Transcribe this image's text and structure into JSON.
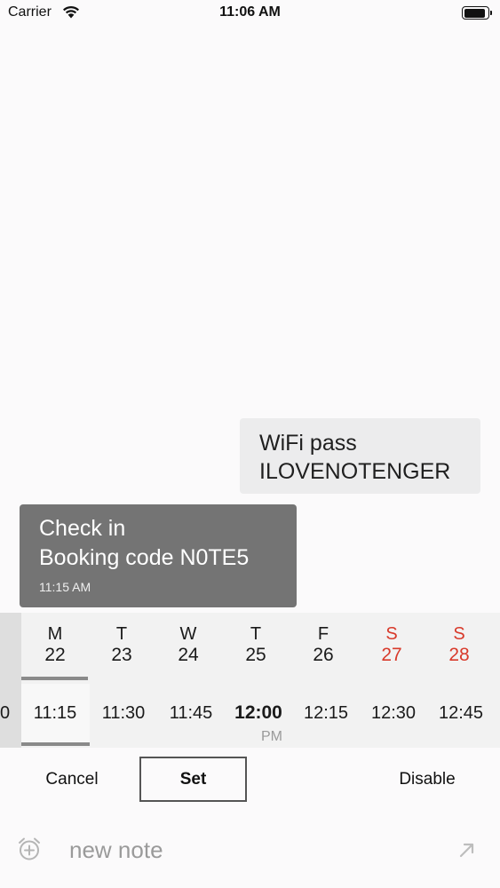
{
  "status_bar": {
    "carrier": "Carrier",
    "time": "11:06 AM",
    "battery_level": 0.9
  },
  "messages": {
    "wifi": {
      "line1": "WiFi pass",
      "line2": "ILOVENOTENGER"
    },
    "checkin": {
      "line1": "Check in",
      "line2": "Booking code N0TE5",
      "time": "11:15 AM"
    }
  },
  "picker": {
    "days": [
      {
        "dow": "M",
        "num": "22",
        "weekend": false
      },
      {
        "dow": "T",
        "num": "23",
        "weekend": false
      },
      {
        "dow": "W",
        "num": "24",
        "weekend": false
      },
      {
        "dow": "T",
        "num": "25",
        "weekend": false
      },
      {
        "dow": "F",
        "num": "26",
        "weekend": false
      },
      {
        "dow": "S",
        "num": "27",
        "weekend": true
      },
      {
        "dow": "S",
        "num": "28",
        "weekend": true
      }
    ],
    "partial_slot": "0",
    "slots": [
      "11:15",
      "11:30",
      "11:45",
      "12:00",
      "12:15",
      "12:30",
      "12:45"
    ],
    "pm_label": "PM",
    "weekend_color": "#d83a2b"
  },
  "actions": {
    "cancel": "Cancel",
    "set": "Set",
    "disable": "Disable"
  },
  "composer": {
    "placeholder": "new note",
    "alarm_icon": "alarm-plus-icon",
    "send_icon": "arrow-up-right-icon"
  }
}
